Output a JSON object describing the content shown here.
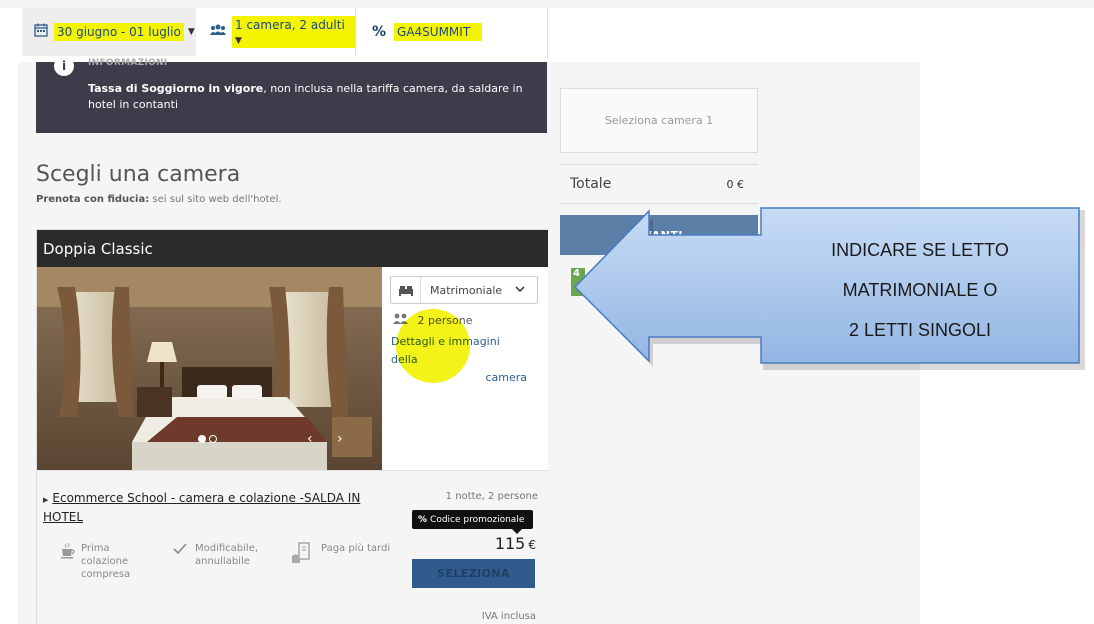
{
  "filters": {
    "dates": "30 giugno - 01 luglio",
    "guests": "1 camera, 2 adulti",
    "promo_symbol": "%",
    "promo_code": "GA4SUMMIT"
  },
  "info": {
    "heading": "INFORMAZIONI",
    "text_bold": "Tassa di Soggiorno in vigore",
    "text_rest": ", non inclusa nella tariffa camera, da saldare in hotel in contanti"
  },
  "main": {
    "title": "Scegli una camera",
    "sub_bold": "Prenota con fiducia:",
    "sub_rest": " sei sul sito web dell'hotel."
  },
  "room": {
    "name": "Doppia Classic",
    "bed_option": "Matrimoniale",
    "persons": "2 persone",
    "details_line1": "Dettagli e immagini della",
    "details_line2": "camera",
    "rate_title": "Ecommerce School - camera e colazione -SALDA IN HOTEL",
    "nights_persons": "1 notte, 2 persone",
    "promo_tag": "Codice promozionale",
    "price": "115",
    "currency": "€",
    "select_label": "SELEZIONA",
    "vat": "IVA inclusa",
    "features": [
      {
        "label": "Prima colazione compresa",
        "icon": "coffee-icon"
      },
      {
        "label": "Modificabile, annullabile",
        "icon": "check-icon"
      },
      {
        "label": "Paga più tardi",
        "icon": "card-icon"
      }
    ]
  },
  "summary": {
    "select_room": "Seleziona camera 1",
    "total_label": "Totale",
    "total_value": "0 €",
    "next_label": "AVANTI",
    "badge": "4"
  },
  "callout": {
    "line1": "INDICARE SE LETTO",
    "line2": "MATRIMONIALE O",
    "line3": "2 LETTI SINGOLI"
  },
  "colors": {
    "highlight": "#f4f400",
    "primary_blue": "#2f5c8d",
    "banner": "#3c3c4a",
    "callout_fill": "#a9c6ec"
  }
}
